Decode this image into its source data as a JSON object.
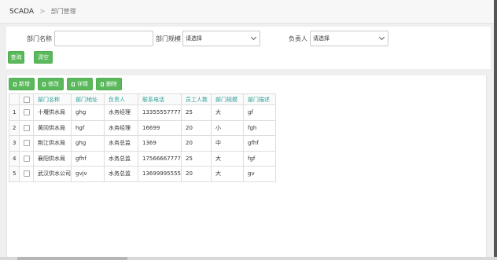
{
  "breadcrumb": {
    "home": "SCADA",
    "separator": ">",
    "current": "部门管理"
  },
  "search": {
    "name_label": "部门名称",
    "name_value": "",
    "scale_label": "部门规模",
    "scale_selected": "请选择",
    "manager_label": "负责人",
    "manager_selected": "请选择",
    "query_label": "查询",
    "clear_label": "清空"
  },
  "toolbar": {
    "add_label": "新增",
    "edit_label": "修改",
    "detail_label": "详情",
    "delete_label": "删除"
  },
  "table": {
    "headers": [
      "部门名称",
      "部门地址",
      "负责人",
      "联系电话",
      "员工人数",
      "部门规模",
      "部门描述"
    ],
    "rows": [
      {
        "no": "1",
        "name": "十堰供水局",
        "address": "ghg",
        "manager": "水务经理",
        "phone": "13355557777",
        "staff": "25",
        "scale": "大",
        "desc": "gf"
      },
      {
        "no": "2",
        "name": "黄冈供水局",
        "address": "hgf",
        "manager": "水务经理",
        "phone": "16699",
        "staff": "20",
        "scale": "小",
        "desc": "fgh"
      },
      {
        "no": "3",
        "name": "荆江供水局",
        "address": "ghg",
        "manager": "水务总监",
        "phone": "1369",
        "staff": "20",
        "scale": "中",
        "desc": "gfhf"
      },
      {
        "no": "4",
        "name": "襄阳供水局",
        "address": "gfhf",
        "manager": "水务总监",
        "phone": "17566667777",
        "staff": "25",
        "scale": "大",
        "desc": "fgf"
      },
      {
        "no": "5",
        "name": "武汉供水公司",
        "address": "gvjv",
        "manager": "水务总监",
        "phone": "13699995555",
        "staff": "20",
        "scale": "大",
        "desc": "gv"
      }
    ]
  }
}
